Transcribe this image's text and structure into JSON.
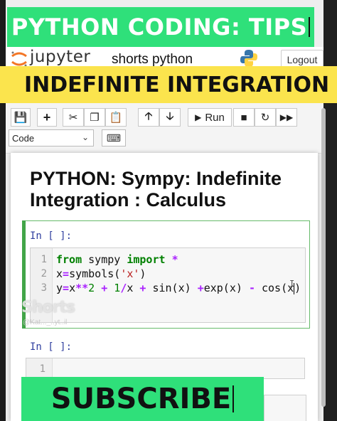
{
  "banners": {
    "top": "PYTHON CODING: TIPS",
    "middle": "INDEFINITE INTEGRATION",
    "bottom": "SUBSCRIBE"
  },
  "header": {
    "logo_text": "jupyter",
    "notebook_name": "shorts python",
    "logout_label": "Logout"
  },
  "toolbar": {
    "run_label": "Run",
    "cell_type": "Code"
  },
  "notebook": {
    "title_line1": "PYTHON: Sympy: Indefinite",
    "title_line2": "Integration : Calculus",
    "cell1": {
      "prompt": "In [ ]:",
      "line_numbers": [
        "1",
        "2",
        "3"
      ]
    },
    "cell2": {
      "prompt": "In [ ]:",
      "line_numbers": [
        "1"
      ]
    }
  },
  "watermark": {
    "logo": "Shorts",
    "handle": "@Kat..._..yt..il"
  },
  "colors": {
    "banner_green": "#2fe07a",
    "banner_yellow": "#fbe44d",
    "cell_active_border": "#66bb6a"
  }
}
